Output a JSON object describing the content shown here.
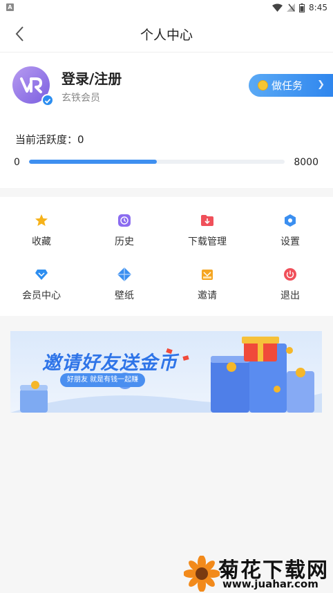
{
  "status_bar": {
    "app_badge": "A",
    "time": "8:45"
  },
  "header": {
    "title": "个人中心"
  },
  "profile": {
    "username": "登录/注册",
    "member_level": "玄铁会员",
    "task_button": "做任务",
    "activity_label": "当前活跃度：0",
    "progress": {
      "min": "0",
      "max": "8000",
      "fill_fraction": 0.5
    }
  },
  "menu": {
    "items": [
      {
        "label": "收藏",
        "icon": "star-icon",
        "color": "#f6b21a"
      },
      {
        "label": "历史",
        "icon": "clock-icon",
        "color": "#8b6cf0"
      },
      {
        "label": "下载管理",
        "icon": "download-folder-icon",
        "color": "#f0505a"
      },
      {
        "label": "设置",
        "icon": "gear-icon",
        "color": "#3b8ff0"
      },
      {
        "label": "会员中心",
        "icon": "diamond-icon",
        "color": "#2d8ef0"
      },
      {
        "label": "壁纸",
        "icon": "wallpaper-icon",
        "color": "#3b8ff0"
      },
      {
        "label": "邀请",
        "icon": "gift-icon",
        "color": "#f5a623"
      },
      {
        "label": "退出",
        "icon": "power-icon",
        "color": "#f0505a"
      }
    ]
  },
  "banner": {
    "title": "邀请好友送金币",
    "subtitle": "好朋友 就是有钱一起赚"
  },
  "watermark": {
    "title": "菊花下载网",
    "url": "www.juahar.com"
  },
  "colors": {
    "accent": "#3e8ff0",
    "task_button": "#2f86ee",
    "background": "#f6f6f6"
  }
}
